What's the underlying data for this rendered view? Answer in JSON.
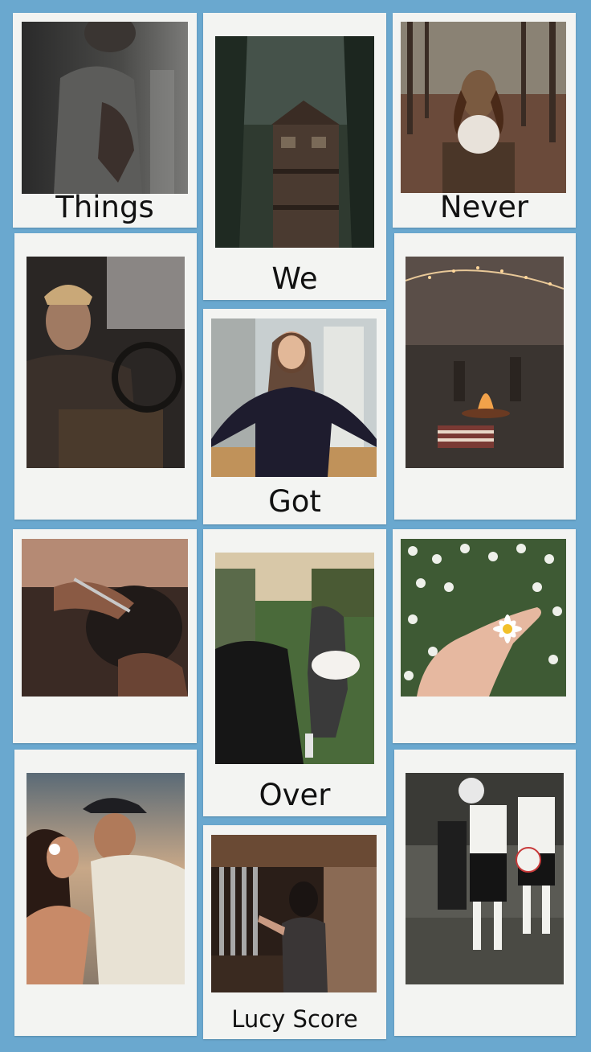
{
  "captions": {
    "things": "Things",
    "never": "Never",
    "we": "We",
    "got": "Got",
    "over": "Over",
    "author": "Lucy Score"
  },
  "colors": {
    "background": "#6aa8cf",
    "card": "#f3f4f2"
  }
}
